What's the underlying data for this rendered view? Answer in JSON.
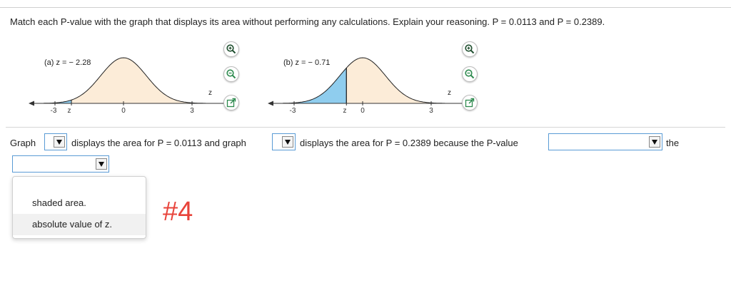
{
  "question": "Match each P-value with the graph that displays its area without performing any calculations. Explain your reasoning. P = 0.0113 and P = 0.2389.",
  "graph_a": {
    "label": "(a) z = − 2.28",
    "axis_var": "z",
    "ticks": [
      "-3",
      "z",
      "0",
      "3"
    ],
    "colors": {
      "fill": "#fcecd8",
      "shade": "#8fcdee"
    }
  },
  "graph_b": {
    "label": "(b) z = − 0.71",
    "axis_var": "z",
    "ticks": [
      "-3",
      "z",
      "0",
      "3"
    ],
    "colors": {
      "fill": "#fcecd8",
      "shade": "#8fcdee"
    }
  },
  "icons": [
    "zoom-in-icon",
    "zoom-out-icon",
    "popout-icon"
  ],
  "answer": {
    "part1": "Graph",
    "part2": "displays the area for P = 0.0113 and graph",
    "part3": "displays the area for P = 0.2389 because the P-value",
    "part4": "the"
  },
  "dropdown": {
    "options": [
      "shaded area.",
      "absolute value of z."
    ],
    "highlighted": "absolute value of z."
  },
  "annotation": "#4",
  "accent": "#5a9bd5"
}
